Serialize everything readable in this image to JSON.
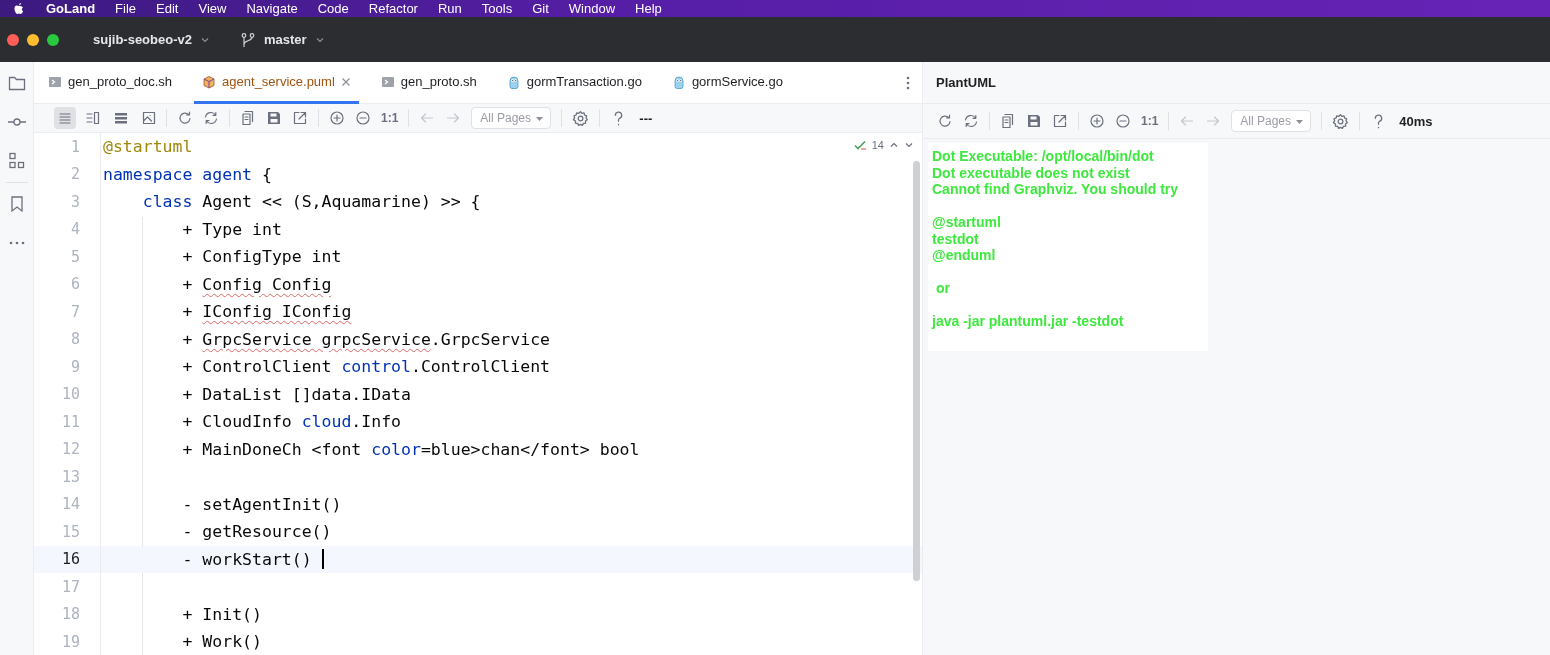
{
  "menu_bar": {
    "app": "GoLand",
    "items": [
      "File",
      "Edit",
      "View",
      "Navigate",
      "Code",
      "Refactor",
      "Run",
      "Tools",
      "Git",
      "Window",
      "Help"
    ]
  },
  "title_bar": {
    "project": "sujib-seobeo-v2",
    "branch": "master"
  },
  "editor": {
    "tabs": [
      {
        "label": "gen_proto_doc.sh",
        "kind": "shell",
        "selected": false,
        "modified": false
      },
      {
        "label": "agent_service.puml",
        "kind": "puml",
        "selected": true,
        "modified": true
      },
      {
        "label": "gen_proto.sh",
        "kind": "shell",
        "selected": false,
        "modified": false
      },
      {
        "label": "gormTransaction.go",
        "kind": "go",
        "selected": false,
        "modified": false
      },
      {
        "label": "gormService.go",
        "kind": "go",
        "selected": false,
        "modified": false
      }
    ],
    "toolbar": {
      "layout_modes": [
        {
          "selected": true
        },
        {
          "selected": false
        },
        {
          "selected": false
        },
        {
          "selected": false
        }
      ],
      "zoom_reset": "1:1",
      "page_select": "All Pages",
      "status": "---"
    },
    "inspection": {
      "count": "14"
    },
    "lines": [
      {
        "number": "1",
        "current": false,
        "tokens": [
          {
            "text": "@startuml",
            "kind": "annotation"
          }
        ]
      },
      {
        "number": "2",
        "current": false,
        "tokens": [
          {
            "text": "namespace agent",
            "kind": "keyword"
          },
          {
            "text": " {",
            "kind": "plain"
          }
        ]
      },
      {
        "number": "3",
        "current": false,
        "tokens": [
          {
            "text": "    class",
            "kind": "keyword"
          },
          {
            "text": " Agent << (S,Aquamarine) >> {",
            "kind": "plain"
          }
        ]
      },
      {
        "number": "4",
        "current": false,
        "tokens": [
          {
            "text": "        + Type int",
            "kind": "plain"
          }
        ]
      },
      {
        "number": "5",
        "current": false,
        "tokens": [
          {
            "text": "        + ConfigType int",
            "kind": "plain"
          }
        ]
      },
      {
        "number": "6",
        "current": false,
        "tokens": [
          {
            "text": "        + ",
            "kind": "plain"
          },
          {
            "text": "Config Config",
            "kind": "typo"
          }
        ]
      },
      {
        "number": "7",
        "current": false,
        "tokens": [
          {
            "text": "        + ",
            "kind": "plain"
          },
          {
            "text": "IConfig IConfig",
            "kind": "typo"
          }
        ]
      },
      {
        "number": "8",
        "current": false,
        "tokens": [
          {
            "text": "        + ",
            "kind": "plain"
          },
          {
            "text": "GrpcService grpcService",
            "kind": "typo"
          },
          {
            "text": ".GrpcService",
            "kind": "plain"
          }
        ]
      },
      {
        "number": "9",
        "current": false,
        "tokens": [
          {
            "text": "        + ControlClient ",
            "kind": "plain"
          },
          {
            "text": "control",
            "kind": "keyword"
          },
          {
            "text": ".ControlClient",
            "kind": "plain"
          }
        ]
      },
      {
        "number": "10",
        "current": false,
        "tokens": [
          {
            "text": "        + DataList []data.IData",
            "kind": "plain"
          }
        ]
      },
      {
        "number": "11",
        "current": false,
        "tokens": [
          {
            "text": "        + CloudInfo ",
            "kind": "plain"
          },
          {
            "text": "cloud",
            "kind": "keyword"
          },
          {
            "text": ".Info",
            "kind": "plain"
          }
        ]
      },
      {
        "number": "12",
        "current": false,
        "tokens": [
          {
            "text": "        + MainDoneCh <font ",
            "kind": "plain"
          },
          {
            "text": "color",
            "kind": "keyword"
          },
          {
            "text": "=blue>chan</font> bool",
            "kind": "plain"
          }
        ]
      },
      {
        "number": "13",
        "current": false
      },
      {
        "number": "14",
        "current": false,
        "tokens": [
          {
            "text": "        - setAgentInit()",
            "kind": "plain"
          }
        ]
      },
      {
        "number": "15",
        "current": false,
        "tokens": [
          {
            "text": "        - getResource()",
            "kind": "plain"
          }
        ]
      },
      {
        "number": "16",
        "current": true,
        "tokens": [
          {
            "text": "        - workStart() ",
            "kind": "plain"
          }
        ]
      },
      {
        "number": "17",
        "current": false
      },
      {
        "number": "18",
        "current": false,
        "tokens": [
          {
            "text": "        + Init()",
            "kind": "plain"
          }
        ]
      },
      {
        "number": "19",
        "current": false,
        "tokens": [
          {
            "text": "        + Work()",
            "kind": "plain"
          }
        ]
      }
    ]
  },
  "preview": {
    "title": "PlantUML",
    "toolbar": {
      "zoom_reset": "1:1",
      "page_select": "All Pages",
      "status": "40ms"
    },
    "output": [
      [
        "Dot Executable: /opt/local/bin/dot",
        "Dot executable does not exist",
        "Cannot find Graphviz. You should try"
      ],
      [
        "@startuml",
        "testdot",
        "@enduml"
      ],
      [
        " or"
      ],
      [
        "java -jar plantuml.jar -testdot"
      ]
    ]
  }
}
